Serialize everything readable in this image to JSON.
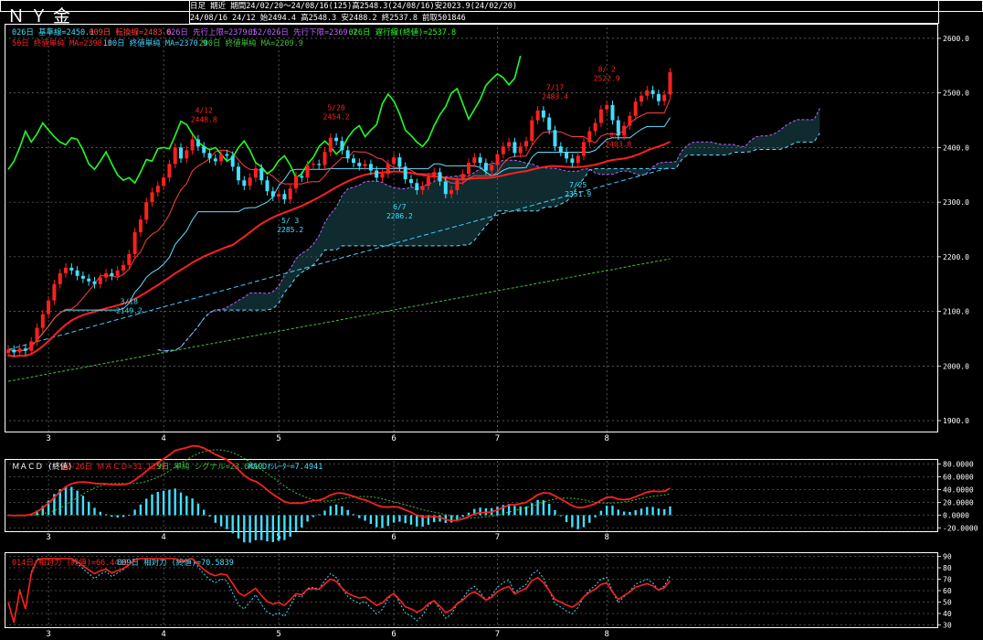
{
  "window": {
    "title": "ＮＹ金",
    "info_line1": "日足 期近 期間24/02/20～24/08/16(125)高2548.3(24/08/16)安2023.9(24/02/20)",
    "info_line2": "24/08/16 24/12 始2494.4 高2548.3 安2488.2 終2537.8 前取501846"
  },
  "colors": {
    "background": "#000000",
    "up_candle": "#ff2020",
    "down_candle": "#40e0ff",
    "ma50": "#ff2020",
    "ma100": "#40d0ff",
    "ma200": "#40c040",
    "chikou": "#20ff20",
    "tenkan": "#ff4040",
    "kijun": "#60e0ff",
    "senkou_a": "#c060ff",
    "senkou_b": "#60e0ff",
    "macd": "#ff2020",
    "signal": "#40c040",
    "osc": "#40e0ff",
    "rsi14": "#ff2020",
    "rsi9": "#40e0ff",
    "grid": "#ffffff"
  },
  "legend": {
    "line1": [
      {
        "text": "026日 基準線=2450.1",
        "color": "#40e0ff"
      },
      {
        "text": "009日 転換線=2483.6",
        "color": "#ff4040"
      },
      {
        "text": "026日 先行上限=2379.1",
        "color": "#c060ff"
      },
      {
        "text": "052/026日 先行下限=2369.7",
        "color": "#c060ff"
      },
      {
        "text": "026日 遅行線(終値)=2537.8",
        "color": "#20ff20"
      }
    ],
    "line2": [
      {
        "text": "50日 終値単純 MA=2398.3",
        "color": "#ff2020"
      },
      {
        "text": "100日 終値単純 MA=2370.9",
        "color": "#40d0ff"
      },
      {
        "text": "200日 終値単純 MA=2209.9",
        "color": "#40c040"
      }
    ],
    "macd": [
      {
        "text": "ＭＡＣＤ (終値)",
        "color": "#ffffff"
      },
      {
        "text": "12-26日 ＭＡＣＤ=31.1359",
        "color": "#ff2020"
      },
      {
        "text": "9日 単純 シグナル=23.6419",
        "color": "#40c040"
      },
      {
        "text": "MACDｵｼﾚｰﾀｰ=7.4941",
        "color": "#40e0ff"
      }
    ],
    "rsi": [
      {
        "text": "014日 相対力 (終値)=66.4410",
        "color": "#ff2020"
      },
      {
        "text": "009日 相対力 (終値)=70.5839",
        "color": "#40e0ff"
      }
    ]
  },
  "chart_data": {
    "type": "candlestick",
    "x_labels": [
      {
        "label": "3",
        "bar": 7
      },
      {
        "label": "4",
        "bar": 27
      },
      {
        "label": "5",
        "bar": 47
      },
      {
        "label": "6",
        "bar": 67
      },
      {
        "label": "7",
        "bar": 85
      },
      {
        "label": "8",
        "bar": 104
      }
    ],
    "price_axis": {
      "ticks": [
        "1900.0",
        "2000.0",
        "2100.0",
        "2200.0",
        "2300.0",
        "2400.0",
        "2500.0",
        "2600.0"
      ],
      "ylim": [
        1880,
        2620
      ]
    },
    "macd_axis": {
      "ticks": [
        "80.0000",
        "60.0000",
        "40.0000",
        "20.0000",
        "0.0000",
        "-20.0000"
      ],
      "ylim": [
        -25,
        85
      ]
    },
    "rsi_axis": {
      "ticks": [
        "90",
        "80",
        "70",
        "60",
        "50",
        "40",
        "30"
      ],
      "ylim": [
        28,
        92
      ]
    },
    "closes": [
      2030,
      2025,
      2032,
      2028,
      2045,
      2070,
      2095,
      2120,
      2150,
      2170,
      2180,
      2175,
      2165,
      2160,
      2155,
      2150,
      2162,
      2170,
      2165,
      2175,
      2185,
      2205,
      2245,
      2268,
      2300,
      2318,
      2330,
      2345,
      2370,
      2400,
      2380,
      2395,
      2415,
      2402,
      2390,
      2380,
      2375,
      2388,
      2385,
      2365,
      2340,
      2330,
      2345,
      2362,
      2340,
      2320,
      2310,
      2315,
      2305,
      2325,
      2348,
      2345,
      2368,
      2370,
      2368,
      2392,
      2418,
      2412,
      2395,
      2380,
      2372,
      2366,
      2370,
      2358,
      2345,
      2352,
      2370,
      2382,
      2365,
      2342,
      2335,
      2322,
      2330,
      2346,
      2355,
      2338,
      2315,
      2322,
      2340,
      2352,
      2372,
      2382,
      2372,
      2358,
      2368,
      2388,
      2402,
      2410,
      2390,
      2402,
      2412,
      2450,
      2468,
      2455,
      2432,
      2402,
      2392,
      2380,
      2372,
      2385,
      2410,
      2430,
      2445,
      2470,
      2478,
      2450,
      2422,
      2440,
      2458,
      2484,
      2495,
      2505,
      2498,
      2485,
      2497,
      2538
    ],
    "highlights": [
      {
        "date": "3/18",
        "value": "2149.2"
      },
      {
        "date": "4/12",
        "value": "2448.8"
      },
      {
        "date": "5/ 3",
        "value": "2285.2"
      },
      {
        "date": "5/20",
        "value": "2454.2"
      },
      {
        "date": "6/7",
        "value": "2286.2"
      },
      {
        "date": "7/17",
        "value": "2483.4"
      },
      {
        "date": "7/25",
        "value": "2351.9"
      },
      {
        "date": "8/ 2",
        "value": "2522.9"
      },
      {
        "date": "8/ 5",
        "value": "2403.8"
      }
    ],
    "highlight_pos": [
      [
        21,
        2127
      ],
      [
        34,
        2440
      ],
      [
        49,
        2275
      ],
      [
        57,
        2445
      ],
      [
        68,
        2300
      ],
      [
        95,
        2482
      ],
      [
        99,
        2340
      ],
      [
        104,
        2515
      ],
      [
        106,
        2395
      ]
    ]
  }
}
